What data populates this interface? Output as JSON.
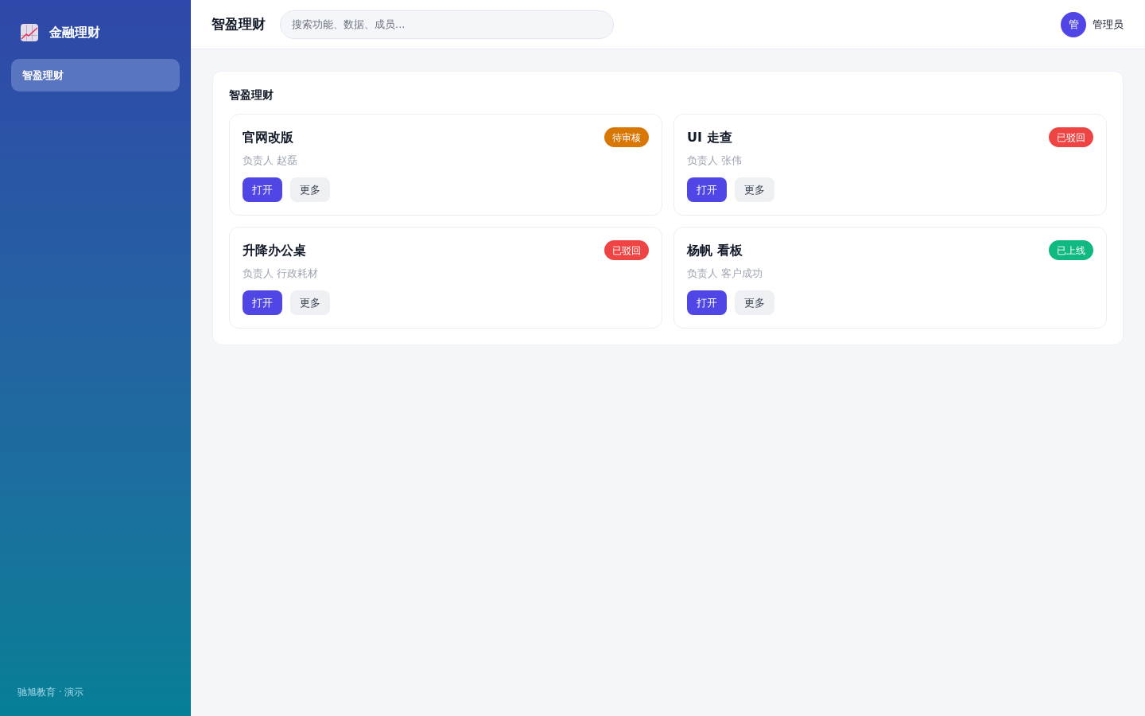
{
  "sidebar": {
    "brand": "金融理财",
    "nav": [
      {
        "label": "智盈理财",
        "selected": true
      }
    ],
    "footer": "驰旭教育 · 演示"
  },
  "header": {
    "title": "智盈理财",
    "search": {
      "placeholder": "搜索功能、数据、成员..."
    },
    "user": {
      "avatar": "管",
      "name": "管理员"
    }
  },
  "panel": {
    "title": "智盈理财",
    "cards": [
      {
        "title": "官网改版",
        "status": {
          "label": "待审核",
          "color": "#d97706"
        },
        "owner": "负责人 赵磊",
        "buttons": [
          {
            "label": "打开",
            "kind": "primary"
          },
          {
            "label": "更多",
            "kind": "secondary"
          }
        ]
      },
      {
        "title": "UI 走查",
        "status": {
          "label": "已驳回",
          "color": "#ef4444"
        },
        "owner": "负责人 张伟",
        "buttons": [
          {
            "label": "打开",
            "kind": "primary"
          },
          {
            "label": "更多",
            "kind": "secondary"
          }
        ]
      },
      {
        "title": "升降办公桌",
        "status": {
          "label": "已驳回",
          "color": "#ef4444"
        },
        "owner": "负责人 行政耗材",
        "buttons": [
          {
            "label": "打开",
            "kind": "primary"
          },
          {
            "label": "更多",
            "kind": "secondary"
          }
        ]
      },
      {
        "title": "杨帆 看板",
        "status": {
          "label": "已上线",
          "color": "#10b981"
        },
        "owner": "负责人 客户成功",
        "buttons": [
          {
            "label": "打开",
            "kind": "primary"
          },
          {
            "label": "更多",
            "kind": "secondary"
          }
        ]
      }
    ]
  }
}
